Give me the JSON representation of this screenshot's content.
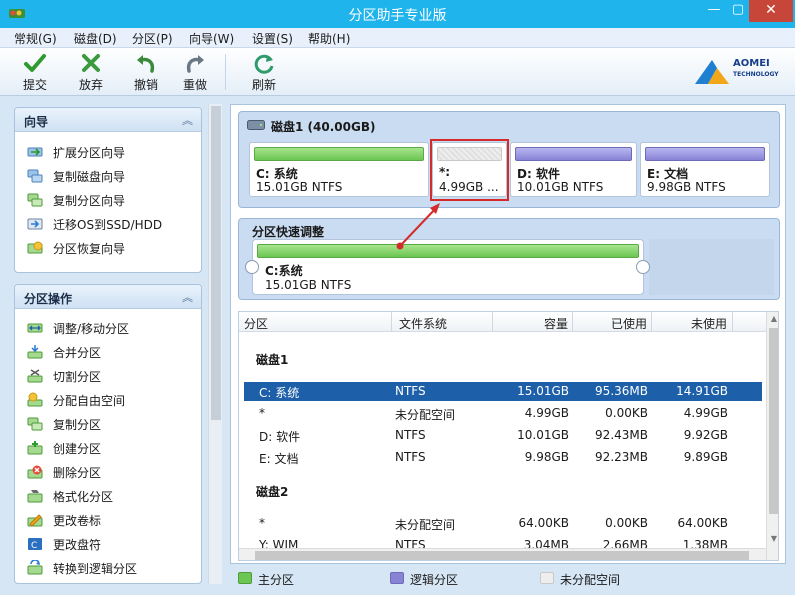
{
  "window": {
    "title": "分区助手专业版",
    "min": "—",
    "max": "▢",
    "close": "✕"
  },
  "menu": [
    "常规(G)",
    "磁盘(D)",
    "分区(P)",
    "向导(W)",
    "设置(S)",
    "帮助(H)"
  ],
  "toolbar": {
    "commit": "提交",
    "discard": "放弃",
    "undo": "撤销",
    "redo": "重做",
    "refresh": "刷新"
  },
  "logo": {
    "line1": "AOMEI",
    "line2": "TECHNOLOGY"
  },
  "wizard_panel": {
    "title": "向导",
    "items": [
      "扩展分区向导",
      "复制磁盘向导",
      "复制分区向导",
      "迁移OS到SSD/HDD",
      "分区恢复向导"
    ]
  },
  "ops_panel": {
    "title": "分区操作",
    "items": [
      "调整/移动分区",
      "合并分区",
      "切割分区",
      "分配自由空间",
      "复制分区",
      "创建分区",
      "删除分区",
      "格式化分区",
      "更改卷标",
      "更改盘符",
      "转换到逻辑分区"
    ]
  },
  "disk1": {
    "title": "磁盘1 (40.00GB)",
    "partitions": [
      {
        "name": "C: 系统",
        "size": "15.01GB NTFS",
        "type": "primary"
      },
      {
        "name": "*:",
        "size": "4.99GB ...",
        "type": "unalloc"
      },
      {
        "name": "D: 软件",
        "size": "10.01GB NTFS",
        "type": "logical"
      },
      {
        "name": "E: 文档",
        "size": "9.98GB NTFS",
        "type": "logical"
      }
    ]
  },
  "quick": {
    "title": "分区快速调整",
    "name": "C:系统",
    "size": "15.01GB NTFS"
  },
  "table": {
    "headers": [
      "分区",
      "文件系统",
      "容量",
      "已使用",
      "未使用"
    ],
    "groups": [
      {
        "label": "磁盘1",
        "rows": [
          [
            "C: 系统",
            "NTFS",
            "15.01GB",
            "95.36MB",
            "14.91GB"
          ],
          [
            "*",
            "未分配空间",
            "4.99GB",
            "0.00KB",
            "4.99GB"
          ],
          [
            "D: 软件",
            "NTFS",
            "10.01GB",
            "92.43MB",
            "9.92GB"
          ],
          [
            "E: 文档",
            "NTFS",
            "9.98GB",
            "92.23MB",
            "9.89GB"
          ]
        ]
      },
      {
        "label": "磁盘2",
        "rows": [
          [
            "*",
            "未分配空间",
            "64.00KB",
            "0.00KB",
            "64.00KB"
          ],
          [
            "Y: WIM",
            "NTFS",
            "3.04MB",
            "2.66MB",
            "1.38MB"
          ]
        ]
      }
    ]
  },
  "legend": {
    "primary": "主分区",
    "logical": "逻辑分区",
    "unalloc": "未分配空间"
  },
  "colors": {
    "titlebar": "#1fb4ec",
    "primary": "#6bc653",
    "logical": "#8784d6",
    "selection": "#1d5fa8",
    "highlight": "#d42a2a"
  }
}
